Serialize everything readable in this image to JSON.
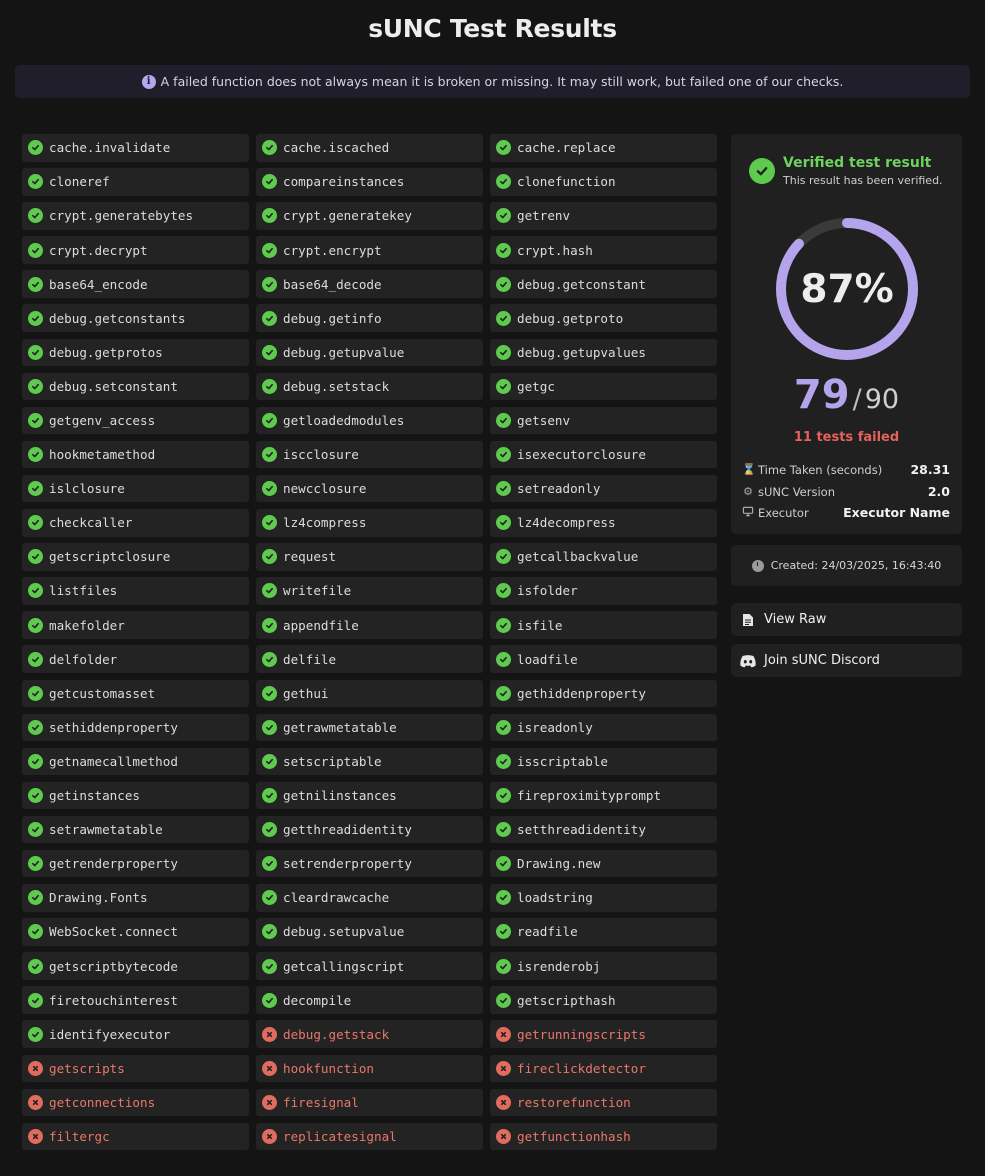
{
  "title": "sUNC Test Results",
  "notice": "A failed function does not always mean it is broken or missing. It may still work, but failed one of our checks.",
  "tests": [
    {
      "name": "cache.invalidate",
      "pass": true
    },
    {
      "name": "cache.iscached",
      "pass": true
    },
    {
      "name": "cache.replace",
      "pass": true
    },
    {
      "name": "cloneref",
      "pass": true
    },
    {
      "name": "compareinstances",
      "pass": true
    },
    {
      "name": "clonefunction",
      "pass": true
    },
    {
      "name": "crypt.generatebytes",
      "pass": true
    },
    {
      "name": "crypt.generatekey",
      "pass": true
    },
    {
      "name": "getrenv",
      "pass": true
    },
    {
      "name": "crypt.decrypt",
      "pass": true
    },
    {
      "name": "crypt.encrypt",
      "pass": true
    },
    {
      "name": "crypt.hash",
      "pass": true
    },
    {
      "name": "base64_encode",
      "pass": true
    },
    {
      "name": "base64_decode",
      "pass": true
    },
    {
      "name": "debug.getconstant",
      "pass": true
    },
    {
      "name": "debug.getconstants",
      "pass": true
    },
    {
      "name": "debug.getinfo",
      "pass": true
    },
    {
      "name": "debug.getproto",
      "pass": true
    },
    {
      "name": "debug.getprotos",
      "pass": true
    },
    {
      "name": "debug.getupvalue",
      "pass": true
    },
    {
      "name": "debug.getupvalues",
      "pass": true
    },
    {
      "name": "debug.setconstant",
      "pass": true
    },
    {
      "name": "debug.setstack",
      "pass": true
    },
    {
      "name": "getgc",
      "pass": true
    },
    {
      "name": "getgenv_access",
      "pass": true
    },
    {
      "name": "getloadedmodules",
      "pass": true
    },
    {
      "name": "getsenv",
      "pass": true
    },
    {
      "name": "hookmetamethod",
      "pass": true
    },
    {
      "name": "iscclosure",
      "pass": true
    },
    {
      "name": "isexecutorclosure",
      "pass": true
    },
    {
      "name": "islclosure",
      "pass": true
    },
    {
      "name": "newcclosure",
      "pass": true
    },
    {
      "name": "setreadonly",
      "pass": true
    },
    {
      "name": "checkcaller",
      "pass": true
    },
    {
      "name": "lz4compress",
      "pass": true
    },
    {
      "name": "lz4decompress",
      "pass": true
    },
    {
      "name": "getscriptclosure",
      "pass": true
    },
    {
      "name": "request",
      "pass": true
    },
    {
      "name": "getcallbackvalue",
      "pass": true
    },
    {
      "name": "listfiles",
      "pass": true
    },
    {
      "name": "writefile",
      "pass": true
    },
    {
      "name": "isfolder",
      "pass": true
    },
    {
      "name": "makefolder",
      "pass": true
    },
    {
      "name": "appendfile",
      "pass": true
    },
    {
      "name": "isfile",
      "pass": true
    },
    {
      "name": "delfolder",
      "pass": true
    },
    {
      "name": "delfile",
      "pass": true
    },
    {
      "name": "loadfile",
      "pass": true
    },
    {
      "name": "getcustomasset",
      "pass": true
    },
    {
      "name": "gethui",
      "pass": true
    },
    {
      "name": "gethiddenproperty",
      "pass": true
    },
    {
      "name": "sethiddenproperty",
      "pass": true
    },
    {
      "name": "getrawmetatable",
      "pass": true
    },
    {
      "name": "isreadonly",
      "pass": true
    },
    {
      "name": "getnamecallmethod",
      "pass": true
    },
    {
      "name": "setscriptable",
      "pass": true
    },
    {
      "name": "isscriptable",
      "pass": true
    },
    {
      "name": "getinstances",
      "pass": true
    },
    {
      "name": "getnilinstances",
      "pass": true
    },
    {
      "name": "fireproximityprompt",
      "pass": true
    },
    {
      "name": "setrawmetatable",
      "pass": true
    },
    {
      "name": "getthreadidentity",
      "pass": true
    },
    {
      "name": "setthreadidentity",
      "pass": true
    },
    {
      "name": "getrenderproperty",
      "pass": true
    },
    {
      "name": "setrenderproperty",
      "pass": true
    },
    {
      "name": "Drawing.new",
      "pass": true
    },
    {
      "name": "Drawing.Fonts",
      "pass": true
    },
    {
      "name": "cleardrawcache",
      "pass": true
    },
    {
      "name": "loadstring",
      "pass": true
    },
    {
      "name": "WebSocket.connect",
      "pass": true
    },
    {
      "name": "debug.setupvalue",
      "pass": true
    },
    {
      "name": "readfile",
      "pass": true
    },
    {
      "name": "getscriptbytecode",
      "pass": true
    },
    {
      "name": "getcallingscript",
      "pass": true
    },
    {
      "name": "isrenderobj",
      "pass": true
    },
    {
      "name": "firetouchinterest",
      "pass": true
    },
    {
      "name": "decompile",
      "pass": true
    },
    {
      "name": "getscripthash",
      "pass": true
    },
    {
      "name": "identifyexecutor",
      "pass": true
    },
    {
      "name": "debug.getstack",
      "pass": false
    },
    {
      "name": "getrunningscripts",
      "pass": false
    },
    {
      "name": "getscripts",
      "pass": false
    },
    {
      "name": "hookfunction",
      "pass": false
    },
    {
      "name": "fireclickdetector",
      "pass": false
    },
    {
      "name": "getconnections",
      "pass": false
    },
    {
      "name": "firesignal",
      "pass": false
    },
    {
      "name": "restorefunction",
      "pass": false
    },
    {
      "name": "filtergc",
      "pass": false
    },
    {
      "name": "replicatesignal",
      "pass": false
    },
    {
      "name": "getfunctionhash",
      "pass": false
    }
  ],
  "result": {
    "verified_title": "Verified test result",
    "verified_sub": "This result has been verified.",
    "percent_text": "87%",
    "percent_value": 0.87,
    "passed": "79",
    "separator": "/",
    "total": "90",
    "failed_text": "11 tests failed",
    "stats": [
      {
        "icon": "hourglass-icon",
        "label": "Time Taken (seconds)",
        "value": "28.31"
      },
      {
        "icon": "gear-icon",
        "label": "sUNC Version",
        "value": "2.0"
      },
      {
        "icon": "monitor-icon",
        "label": "Executor",
        "value": "Executor Name"
      }
    ]
  },
  "created": "Created: 24/03/2025, 16:43:40",
  "buttons": {
    "view_raw": "View Raw",
    "discord": "Join sUNC Discord"
  },
  "colors": {
    "pass": "#5ecb4f",
    "fail": "#e06b5f",
    "accent": "#b4a4ec",
    "ring_track": "#3a3a3a"
  }
}
